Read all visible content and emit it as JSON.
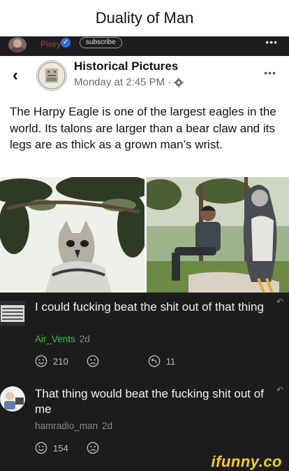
{
  "meme": {
    "title": "Duality of Man"
  },
  "top_strip": {
    "name": "Pixey",
    "subscribe": "subscribe",
    "more": "•••"
  },
  "post": {
    "page_name": "Historical Pictures",
    "timestamp": "Monday at 2:45 PM ·",
    "more": "•••",
    "text": "The Harpy Eagle is one of the largest eagles in the world. Its talons are larger than a bear claw and its legs are as thick as a grown man’s wrist."
  },
  "comments": [
    {
      "text": "I could fucking beat the shit out of that thing",
      "username": "Air_Vents",
      "age": "2d",
      "smile_count": "210",
      "reply_count": "11",
      "username_color": "#3fbf3f"
    },
    {
      "text": "That thing would beat the fucking shit out of me",
      "username": "hamradio_man",
      "age": "2d",
      "smile_count": "154",
      "username_color": "#8a8a8a"
    }
  ],
  "watermark": "ifunny.co",
  "icons": [
    "back-icon",
    "gear-icon",
    "smile-icon",
    "frown-icon",
    "reply-icon",
    "verified-icon"
  ]
}
